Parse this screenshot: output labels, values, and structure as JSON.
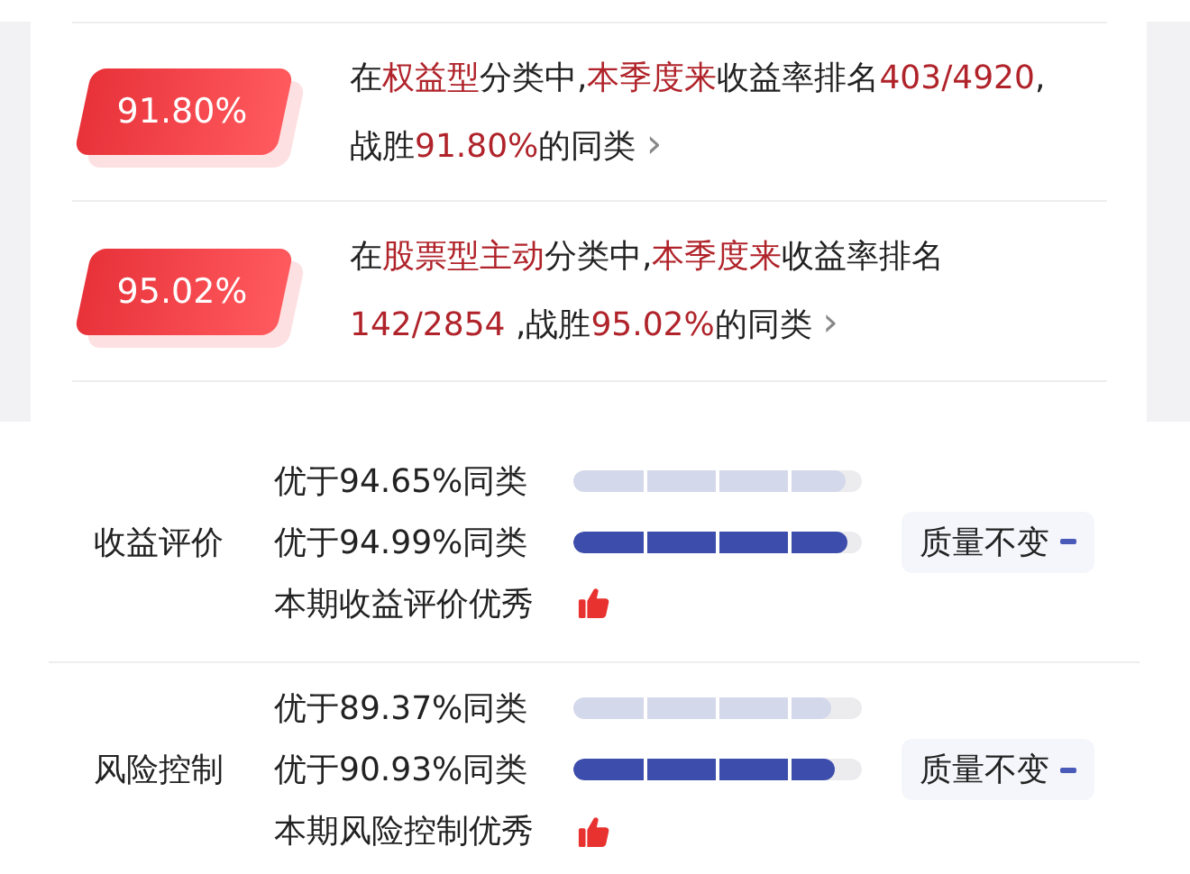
{
  "rankings": [
    {
      "badge": "91.80%",
      "parts": [
        {
          "text": "在",
          "highlight": false
        },
        {
          "text": "权益型",
          "highlight": true
        },
        {
          "text": "分类中,",
          "highlight": false
        },
        {
          "text": "本季度来",
          "highlight": true
        },
        {
          "text": "收益率排名",
          "highlight": false
        },
        {
          "text": "403/4920",
          "highlight": true
        },
        {
          "text": ",战胜",
          "highlight": false
        },
        {
          "text": "91.80%",
          "highlight": true
        },
        {
          "text": "的同类",
          "highlight": false
        }
      ],
      "chevron": "›"
    },
    {
      "badge": "95.02%",
      "parts": [
        {
          "text": "在",
          "highlight": false
        },
        {
          "text": "股票型主动",
          "highlight": true
        },
        {
          "text": "分类中,",
          "highlight": false
        },
        {
          "text": "本季度来",
          "highlight": true
        },
        {
          "text": "收益率排名 ",
          "highlight": false
        },
        {
          "text": "142/2854",
          "highlight": true
        },
        {
          "text": " ,战胜",
          "highlight": false
        },
        {
          "text": "95.02%",
          "highlight": true
        },
        {
          "text": "的同类",
          "highlight": false
        }
      ],
      "chevron": "›"
    }
  ],
  "evaluations": [
    {
      "label": "收益评价",
      "bars": [
        {
          "text": "优于94.65%同类",
          "kind": "previous",
          "level": 0.9465
        },
        {
          "text": "优于94.99%同类",
          "kind": "current",
          "level": 0.9499
        }
      ],
      "verdict": "本期收益评价优秀",
      "status": "质量不变"
    },
    {
      "label": "风险控制",
      "bars": [
        {
          "text": "优于89.37%同类",
          "kind": "previous",
          "level": 0.8937
        },
        {
          "text": "优于90.93%同类",
          "kind": "current",
          "level": 0.9093
        }
      ],
      "verdict": "本期风险控制优秀",
      "status": "质量不变"
    }
  ]
}
